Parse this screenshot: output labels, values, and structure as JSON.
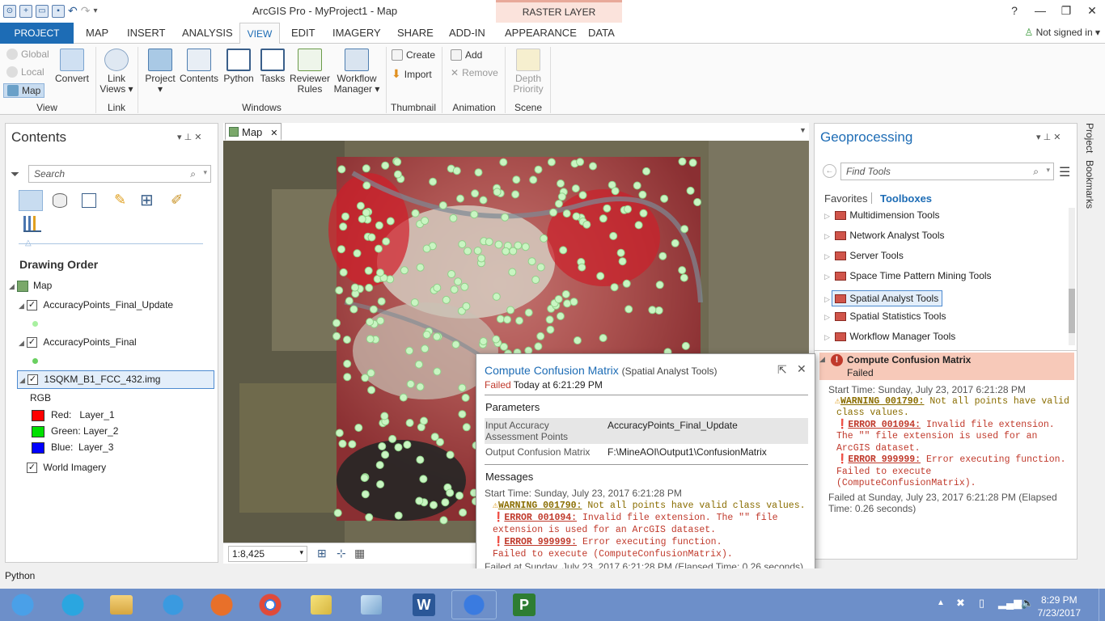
{
  "window": {
    "title": "ArcGIS Pro - MyProject1 - Map",
    "contextual_tab": "RASTER LAYER"
  },
  "tabs": [
    "PROJECT",
    "MAP",
    "INSERT",
    "ANALYSIS",
    "VIEW",
    "EDIT",
    "IMAGERY",
    "SHARE",
    "ADD-IN",
    "APPEARANCE",
    "DATA"
  ],
  "signin": "Not signed in",
  "ribbon": {
    "view_group": {
      "global": "Global",
      "local": "Local",
      "map": "Map",
      "convert": "Convert",
      "label": "View"
    },
    "link_group": {
      "link_views": "Link Views",
      "label": "Link"
    },
    "windows_group": {
      "project": "Project",
      "contents": "Contents",
      "python": "Python",
      "tasks": "Tasks",
      "reviewer_rules": "Reviewer Rules",
      "workflow_manager": "Workflow Manager",
      "label": "Windows"
    },
    "thumbnail_group": {
      "create": "Create",
      "import": "Import",
      "label": "Thumbnail"
    },
    "animation_group": {
      "add": "Add",
      "remove": "Remove",
      "label": "Animation"
    },
    "scene_group": {
      "depth_priority": "Depth Priority",
      "label": "Scene"
    }
  },
  "contents": {
    "title": "Contents",
    "search_placeholder": "Search",
    "drawing_order": "Drawing Order",
    "map": "Map",
    "layers": [
      {
        "name": "AccuracyPoints_Final_Update"
      },
      {
        "name": "AccuracyPoints_Final"
      },
      {
        "name": "1SQKM_B1_FCC_432.img"
      }
    ],
    "rgb": "RGB",
    "bands": [
      {
        "label": "Red:   Layer_1",
        "color": "#ff0000"
      },
      {
        "label": "Green: Layer_2",
        "color": "#00e000"
      },
      {
        "label": "Blue:  Layer_3",
        "color": "#0000ff"
      }
    ],
    "world_imagery": "World Imagery"
  },
  "map": {
    "tab_label": "Map",
    "scale": "1:8,425"
  },
  "geoprocessing": {
    "title": "Geoprocessing",
    "search_placeholder": "Find Tools",
    "favorites": "Favorites",
    "toolboxes": "Toolboxes",
    "tools": [
      "Multidimension Tools",
      "Network Analyst Tools",
      "Server Tools",
      "Space Time Pattern Mining Tools",
      "Spatial Analyst Tools",
      "Spatial Statistics Tools",
      "Workflow Manager Tools"
    ],
    "result": {
      "title": "Compute Confusion Matrix",
      "status": "Failed",
      "start_time": "Start Time: Sunday, July 23, 2017 6:21:28 PM",
      "warning_code": "WARNING 001790:",
      "warning_text": " Not all points have valid class values.",
      "error1_code": "ERROR 001094:",
      "error1_text": " Invalid file extension. The \"\" file extension is used for an ArcGIS dataset.",
      "error2_code": "ERROR 999999:",
      "error2_text": " Error executing function.",
      "failed_exec": "Failed to execute (ComputeConfusionMatrix).",
      "end_time": "Failed at Sunday, July 23, 2017 6:21:28 PM (Elapsed Time: 0.26 seconds)"
    }
  },
  "side_tabs": [
    "Project",
    "Bookmarks"
  ],
  "popup": {
    "title": "Compute Confusion Matrix",
    "subtitle": "(Spatial Analyst Tools)",
    "status": "Failed",
    "status_time": " Today at 6:21:29 PM",
    "parameters_label": "Parameters",
    "params": [
      {
        "name": "Input Accuracy Assessment Points",
        "value": "AccuracyPoints_Final_Update"
      },
      {
        "name": "Output Confusion Matrix",
        "value": "F:\\MineAOI\\Output1\\ConfusionMatrix"
      }
    ],
    "messages_label": "Messages",
    "start_time": "Start Time: Sunday, July 23, 2017 6:21:28 PM",
    "warning_code": "WARNING 001790:",
    "warning_text": " Not all points have valid class values.",
    "error1_code": "ERROR 001094:",
    "error1_text": " Invalid file extension. The \"\" file extension is used for an ArcGIS dataset.",
    "error2_code": "ERROR 999999:",
    "error2_text": " Error executing function.",
    "failed_exec": "Failed to execute (ComputeConfusionMatrix).",
    "end_time": "Failed at Sunday, July 23, 2017 6:21:28 PM (Elapsed Time: 0.26 seconds)"
  },
  "bottom": {
    "python_label": "Python"
  },
  "taskbar": {
    "time": "8:29 PM",
    "date": "7/23/2017"
  }
}
